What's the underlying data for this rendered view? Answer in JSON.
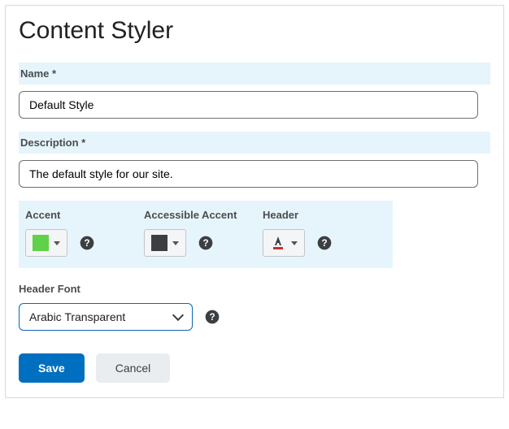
{
  "page": {
    "title": "Content Styler"
  },
  "fields": {
    "name": {
      "label": "Name",
      "required": "*",
      "value": "Default Style"
    },
    "description": {
      "label": "Description",
      "required": "*",
      "value": "The default style for our site."
    }
  },
  "colors": {
    "accent": {
      "label": "Accent",
      "swatch": "#5fd24a"
    },
    "accessible": {
      "label": "Accessible Accent",
      "swatch": "#3c3f42"
    },
    "header": {
      "label": "Header"
    }
  },
  "font": {
    "label": "Header Font",
    "value": "Arabic Transparent"
  },
  "actions": {
    "save": "Save",
    "cancel": "Cancel"
  }
}
